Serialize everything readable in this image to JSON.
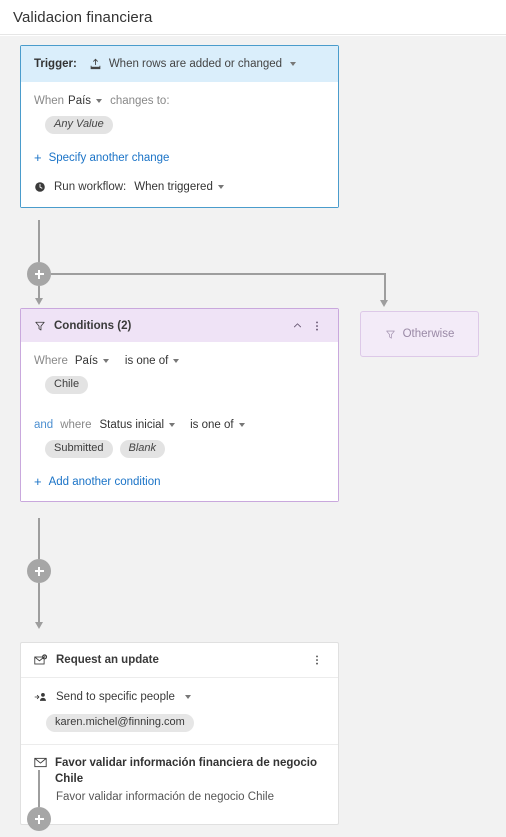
{
  "header": {
    "title": "Validacion financiera"
  },
  "canvas": {
    "background_color": "#f2f2f2"
  },
  "trigger_card": {
    "accent_color": "#4a9ccc",
    "header_background": "#daeefb",
    "label": "Trigger:",
    "icon": "upload-rows-icon",
    "value": "When rows are added or changed",
    "when_label": "When",
    "when_column": "País",
    "changes_to_label": "changes to:",
    "value_pill": "Any Value",
    "add_change_link": "Specify another change",
    "run_workflow_label": "Run workflow:",
    "run_workflow_value": "When triggered",
    "run_workflow_icon": "clock-icon"
  },
  "conditions_card": {
    "accent_color": "#c9a8dd",
    "header_background": "#efe3f6",
    "icon": "filter-icon",
    "title": "Conditions (2)",
    "collapse_icon": "chevron-up-icon",
    "menu_icon": "kebab-menu-icon",
    "condition_1": {
      "prefix": "Where",
      "column": "País",
      "operator": "is one of",
      "values": [
        "Chile"
      ]
    },
    "condition_2": {
      "conjunction": "and",
      "prefix": "where",
      "column": "Status inicial",
      "operator": "is one of",
      "values": [
        "Submitted",
        "Blank"
      ]
    },
    "add_condition_link": "Add another condition"
  },
  "otherwise_branch": {
    "icon": "filter-icon",
    "label": "Otherwise",
    "background": "#f3ebf8",
    "border_color": "#ddc9e8"
  },
  "request_card": {
    "icon": "request-update-icon",
    "title": "Request an update",
    "menu_icon": "kebab-menu-icon",
    "recipient_icon": "add-person-icon",
    "recipient_mode": "Send to specific people",
    "recipients": [
      "karen.michel@finning.com"
    ],
    "subject_icon": "envelope-icon",
    "subject": "Favor validar información financiera de negocio Chile",
    "body": "Favor validar información de negocio Chile"
  },
  "connectors": {
    "add_step_label": "+",
    "line_color": "#9e9e9e",
    "node_color": "#a6a6a6"
  }
}
